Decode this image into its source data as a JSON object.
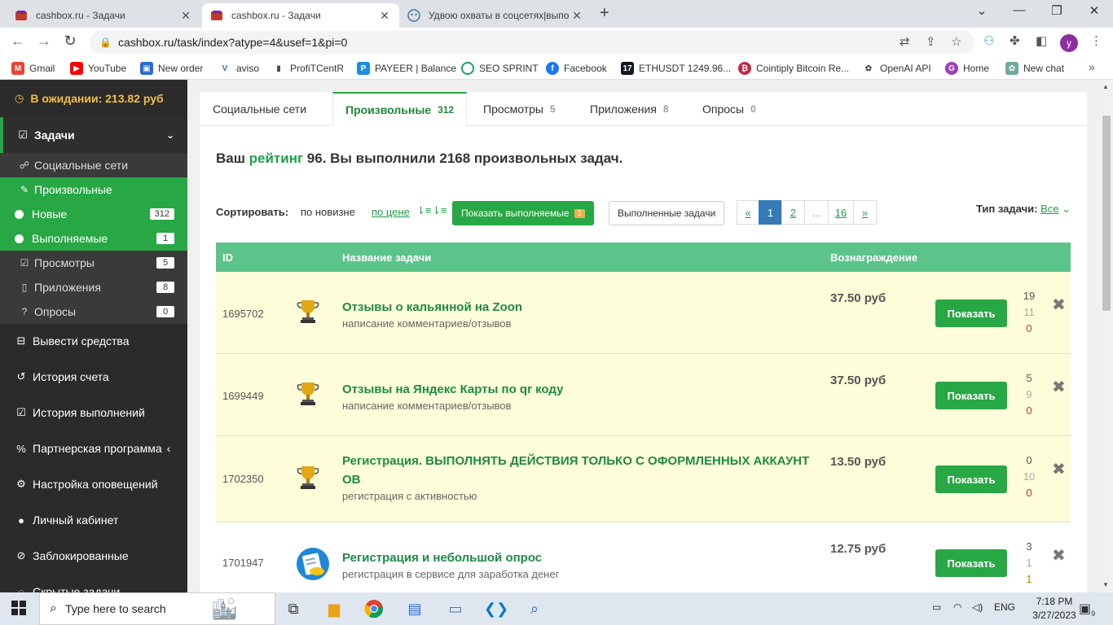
{
  "browser": {
    "tabs": [
      {
        "title": "cashbox.ru - Задачи",
        "active": false
      },
      {
        "title": "cashbox.ru - Задачи",
        "active": true
      },
      {
        "title": "Удвою охваты в соцсетях|выпо",
        "active": false
      }
    ],
    "url": "cashbox.ru/task/index?atype=4&usef=1&pi=0",
    "profile_initial": "y"
  },
  "bookmarks": [
    {
      "label": "Gmail",
      "icon": "gmail-icon",
      "color": "#ea4335"
    },
    {
      "label": "YouTube",
      "icon": "youtube-icon",
      "color": "#ff0000"
    },
    {
      "label": "New order",
      "icon": "cube-icon",
      "color": "#2a6bd1"
    },
    {
      "label": "aviso",
      "icon": "aviso-icon",
      "color": "#3a6fb7"
    },
    {
      "label": "ProfiTCentR",
      "icon": "bar-chart-icon",
      "color": "#444444"
    },
    {
      "label": "PAYEER | Balance",
      "icon": "payeer-icon",
      "color": "#1d8ce0"
    },
    {
      "label": "SEO SPRINT",
      "icon": "target-icon",
      "color": "#1aa260"
    },
    {
      "label": "Facebook",
      "icon": "facebook-icon",
      "color": "#1877f2"
    },
    {
      "label": "ETHUSDT 1249.96...",
      "icon": "tradingview-icon",
      "color": "#131722"
    },
    {
      "label": "Cointiply Bitcoin Re...",
      "icon": "bitcoin-icon",
      "color": "#c0284a"
    },
    {
      "label": "OpenAI API",
      "icon": "openai-icon",
      "color": "#222222"
    },
    {
      "label": "Home",
      "icon": "home-g-icon",
      "color": "#9b3fb5"
    },
    {
      "label": "New chat",
      "icon": "openai-chat-icon",
      "color": "#74aa9c"
    }
  ],
  "sidebar": {
    "pending": "В ожидании: 213.82 руб",
    "tasks_label": "Задачи",
    "items": [
      {
        "label": "Социальные сети",
        "badge": null
      },
      {
        "label": "Произвольные",
        "badge": null
      },
      {
        "label": "Новые",
        "badge": "312"
      },
      {
        "label": "Выполняемые",
        "badge": "1"
      },
      {
        "label": "Просмотры",
        "badge": "5"
      },
      {
        "label": "Приложения",
        "badge": "8"
      },
      {
        "label": "Опросы",
        "badge": "0"
      }
    ],
    "menu": [
      {
        "label": "Вывести средства"
      },
      {
        "label": "История счета"
      },
      {
        "label": "История выполнений"
      },
      {
        "label": "Партнерская программа"
      },
      {
        "label": "Настройка оповещений"
      },
      {
        "label": "Личный кабинет"
      },
      {
        "label": "Заблокированные"
      },
      {
        "label": "Скрытые задачи"
      }
    ]
  },
  "main_tabs": [
    {
      "label": "Социальные сети",
      "count": ""
    },
    {
      "label": "Произвольные",
      "count": "312"
    },
    {
      "label": "Просмотры",
      "count": "5"
    },
    {
      "label": "Приложения",
      "count": "8"
    },
    {
      "label": "Опросы",
      "count": "0"
    }
  ],
  "rating": {
    "prefix": "Ваш",
    "link": "рейтинг",
    "suffix": "96. Вы выполнили 2168 произвольных задач."
  },
  "controls": {
    "sort_label": "Сортировать:",
    "sort_new": "по новизне",
    "sort_price": "по цене",
    "show_done_btn": "Показать выполняемые",
    "show_done_count": "1",
    "completed_btn": "Выполненные задачи",
    "pager": [
      "«",
      "1",
      "2",
      "...",
      "16",
      "»"
    ],
    "pager_active": "1",
    "task_type_label": "Тип задачи:",
    "task_type_value": "Все"
  },
  "table": {
    "headers": {
      "id": "ID",
      "name": "Название задачи",
      "reward": "Вознаграждение"
    },
    "show_label": "Показать",
    "rows": [
      {
        "id": "1695702",
        "icon": "trophy-icon",
        "name": "Отзывы о кальянной на Zoon",
        "category": "написание комментариев/отзывов",
        "reward": "37.50 руб",
        "stats": [
          "19",
          "11",
          "0"
        ]
      },
      {
        "id": "1699449",
        "icon": "trophy-icon",
        "name": "Отзывы на Яндекс Карты по qr коду",
        "category": "написание комментариев/отзывов",
        "reward": "37.50 руб",
        "stats": [
          "5",
          "9",
          "0"
        ]
      },
      {
        "id": "1702350",
        "icon": "trophy-icon",
        "name": "Регистрация. ВЫПОЛНЯТЬ ДЕЙСТВИЯ ТОЛЬКО С ОФОРМЛЕННЫХ АККАУНТ ОВ",
        "category": "регистрация с активностью",
        "reward": "13.50 руб",
        "stats": [
          "0",
          "10",
          "0"
        ]
      },
      {
        "id": "1701947",
        "icon": "survey-icon",
        "name": "Регистрация и небольшой опрос",
        "category": "регистрация в сервисе для заработка денег",
        "reward": "12.75 руб",
        "stats": [
          "3",
          "1",
          "1"
        ]
      }
    ]
  },
  "taskbar": {
    "search_placeholder": "Type here to search",
    "lang": "ENG",
    "time": "7:18 PM",
    "date": "3/27/2023",
    "notifications": "9"
  },
  "colors": {
    "accent_green": "#28a745",
    "header_green": "#5bc48a",
    "row_yellow": "#fdfdd9",
    "sidebar_dark": "#2b2b2b"
  }
}
